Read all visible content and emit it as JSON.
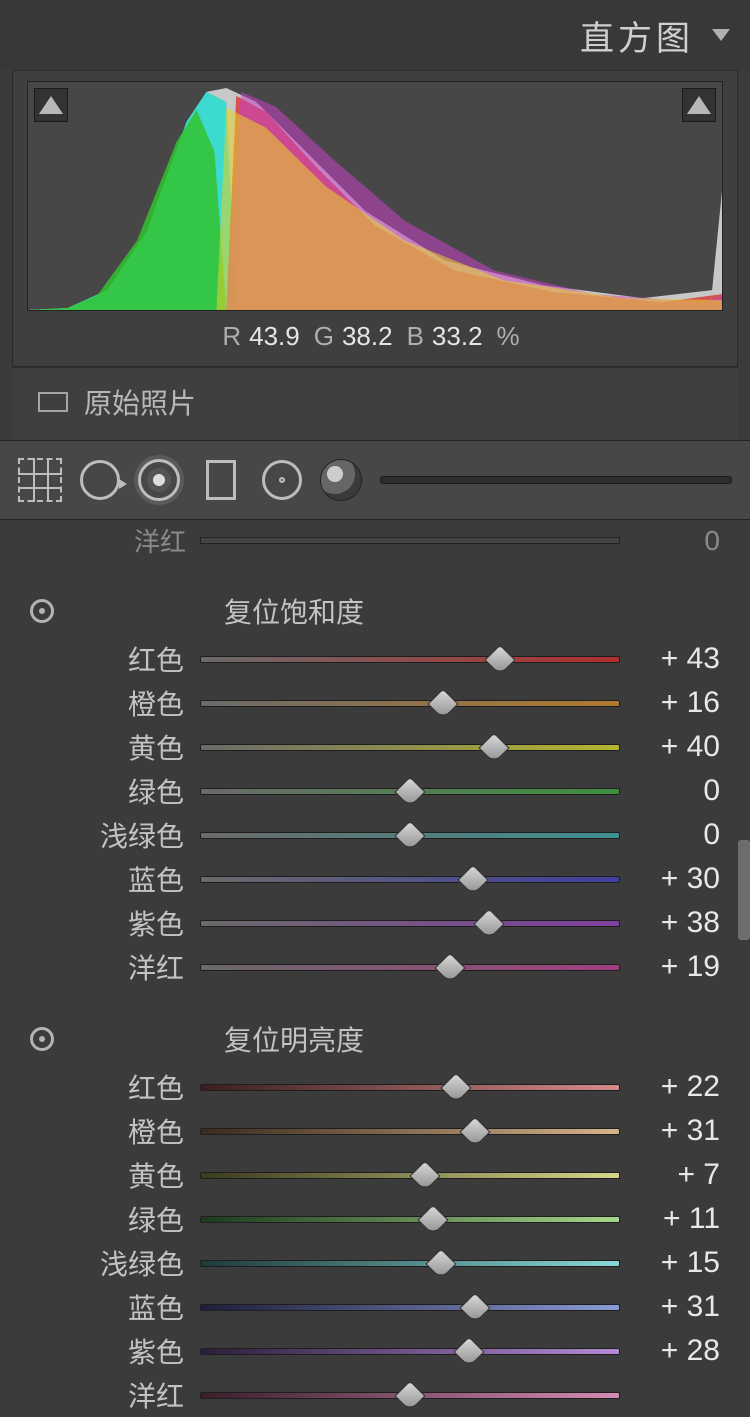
{
  "panel": {
    "title": "直方图"
  },
  "histogram": {
    "readout": {
      "r_label": "R",
      "r_value": "43.9",
      "g_label": "G",
      "g_value": "38.2",
      "b_label": "B",
      "b_value": "33.2",
      "pct": "%"
    },
    "shadow_clip_enabled": true,
    "highlight_clip_enabled": true
  },
  "original": {
    "label": "原始照片"
  },
  "toolstrip": {
    "tools": [
      "crop",
      "spot",
      "redeye",
      "rect",
      "radial",
      "range"
    ]
  },
  "partialTop": {
    "label": "洋红",
    "value": "0"
  },
  "groups": [
    {
      "title": "复位饱和度",
      "sliders": [
        {
          "label": "红色",
          "value": "+ 43",
          "num": 43,
          "gradA": "#6a6a6a",
          "gradB": "#b02f2f"
        },
        {
          "label": "橙色",
          "value": "+ 16",
          "num": 16,
          "gradA": "#6a6a6a",
          "gradB": "#b07a2f"
        },
        {
          "label": "黄色",
          "value": "+ 40",
          "num": 40,
          "gradA": "#6a6a6a",
          "gradB": "#b5b52f"
        },
        {
          "label": "绿色",
          "value": "0",
          "num": 0,
          "gradA": "#6a6a6a",
          "gradB": "#3f8f3f"
        },
        {
          "label": "浅绿色",
          "value": "0",
          "num": 0,
          "gradA": "#6a6a6a",
          "gradB": "#3f8f8f"
        },
        {
          "label": "蓝色",
          "value": "+ 30",
          "num": 30,
          "gradA": "#6a6a6a",
          "gradB": "#3f3f9f"
        },
        {
          "label": "紫色",
          "value": "+ 38",
          "num": 38,
          "gradA": "#6a6a6a",
          "gradB": "#7f3f9f"
        },
        {
          "label": "洋红",
          "value": "+ 19",
          "num": 19,
          "gradA": "#6a6a6a",
          "gradB": "#9f3f7f"
        }
      ]
    },
    {
      "title": "复位明亮度",
      "sliders": [
        {
          "label": "红色",
          "value": "+ 22",
          "num": 22,
          "gradA": "#3a1e1e",
          "gradB": "#d68a8a"
        },
        {
          "label": "橙色",
          "value": "+ 31",
          "num": 31,
          "gradA": "#3a2a1e",
          "gradB": "#d6b48a"
        },
        {
          "label": "黄色",
          "value": "+ 7",
          "num": 7,
          "gradA": "#3a3a1e",
          "gradB": "#d6d68a"
        },
        {
          "label": "绿色",
          "value": "+ 11",
          "num": 11,
          "gradA": "#1e3a1e",
          "gradB": "#a6d68a"
        },
        {
          "label": "浅绿色",
          "value": "+ 15",
          "num": 15,
          "gradA": "#1e3a3a",
          "gradB": "#8ad6d6"
        },
        {
          "label": "蓝色",
          "value": "+ 31",
          "num": 31,
          "gradA": "#1e1e3a",
          "gradB": "#8a9ad6"
        },
        {
          "label": "紫色",
          "value": "+ 28",
          "num": 28,
          "gradA": "#2a1e3a",
          "gradB": "#b48ad6"
        },
        {
          "label": "洋红",
          "value": "",
          "num": 0,
          "gradA": "#3a1e2a",
          "gradB": "#d68ab4"
        }
      ]
    }
  ]
}
